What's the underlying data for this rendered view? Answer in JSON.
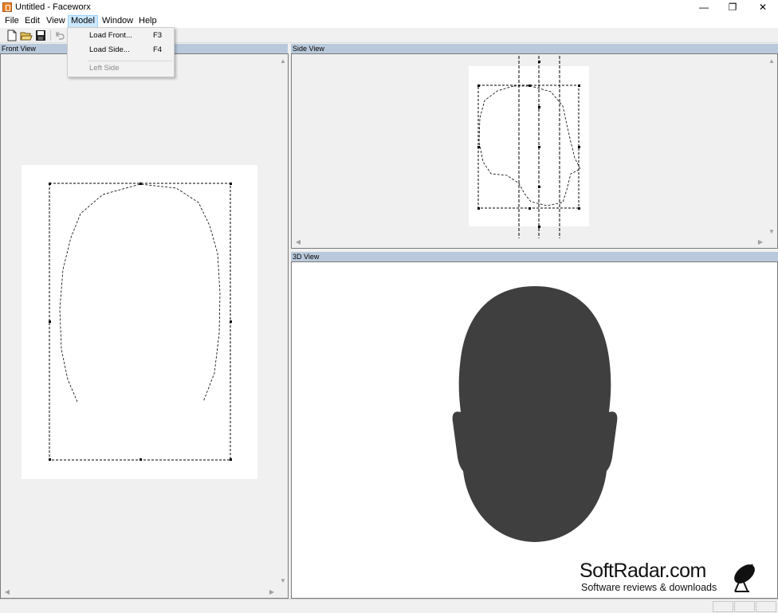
{
  "window": {
    "title": "Untitled - Faceworx",
    "minimize_glyph": "—",
    "maximize_glyph": "❐",
    "close_glyph": "✕"
  },
  "menubar": {
    "items": [
      "File",
      "Edit",
      "View",
      "Model",
      "Window",
      "Help"
    ],
    "active": "Model"
  },
  "toolbar": {
    "icons": [
      "new-file-icon",
      "open-folder-icon",
      "save-disk-icon",
      "undo-icon"
    ]
  },
  "model_menu": {
    "items": [
      {
        "label": "Load Front...",
        "shortcut": "F3",
        "enabled": true
      },
      {
        "label": "Load Side...",
        "shortcut": "F4",
        "enabled": true
      },
      {
        "label": "Left Side",
        "shortcut": "",
        "enabled": false
      }
    ]
  },
  "panes": {
    "front": {
      "title": "Front View"
    },
    "side": {
      "title": "Side View"
    },
    "threed": {
      "title": "3D View"
    }
  },
  "colors": {
    "pane_title_bg": "#b9c9db",
    "head_fill": "#3f3f3f",
    "menu_highlight": "#cce8ff"
  },
  "watermark": {
    "title": "SoftRadar.com",
    "subtitle": "Software reviews & downloads"
  }
}
